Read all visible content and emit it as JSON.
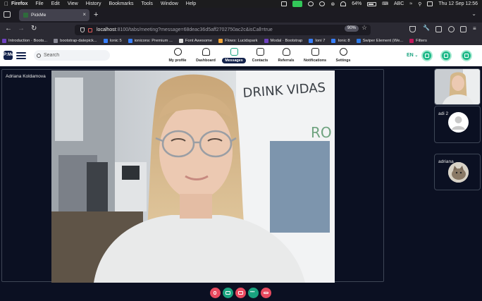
{
  "menubar": {
    "app": "Firefox",
    "menus": [
      "File",
      "Edit",
      "View",
      "History",
      "Bookmarks",
      "Tools",
      "Window",
      "Help"
    ],
    "battery": "64%",
    "input_source": "ABC",
    "datetime": "Thu 12 Sep  12:56"
  },
  "browser": {
    "tab_title": "PickMe",
    "url_host": "localhost",
    "url_path": ":8100/tabs/meeting?message=68deac36d5aff2702750ac2c&isCall=true",
    "zoom": "90%"
  },
  "bookmarks": [
    {
      "label": "Introduction · Boots...",
      "icon": "bootstrap-icon",
      "color": "#6f42c1"
    },
    {
      "label": "bootstrap-datepick...",
      "icon": "document-icon",
      "color": "#8a8a96"
    },
    {
      "label": "Ionic 5",
      "icon": "ionic-icon",
      "color": "#3880ff"
    },
    {
      "label": "ionicons: Premium ...",
      "icon": "ionicons-icon",
      "color": "#3880ff"
    },
    {
      "label": "Font Awesome",
      "icon": "fontawesome-icon",
      "color": "#d9d9d9"
    },
    {
      "label": "Flows: Lucidspark",
      "icon": "lucid-icon",
      "color": "#f2a63a"
    },
    {
      "label": "Modal · Bootstrap",
      "icon": "bootstrap-icon",
      "color": "#6f42c1"
    },
    {
      "label": "Ioni 7",
      "icon": "ionic-icon",
      "color": "#3880ff"
    },
    {
      "label": "Ionic 8",
      "icon": "ionic-icon",
      "color": "#3880ff"
    },
    {
      "label": "Swiper Element (We...",
      "icon": "swiper-icon",
      "color": "#2f7be6"
    },
    {
      "label": "Filters",
      "icon": "filters-icon",
      "color": "#c2185b"
    }
  ],
  "app": {
    "logo": "P:Me",
    "search_placeholder": "Search",
    "nav": [
      {
        "label": "My profile",
        "icon": "user-icon",
        "active": false
      },
      {
        "label": "Dashboard",
        "icon": "home-icon",
        "active": false
      },
      {
        "label": "Messages",
        "icon": "chat-icon",
        "active": true
      },
      {
        "label": "Contacts",
        "icon": "contacts-icon",
        "active": false
      },
      {
        "label": "Referrals",
        "icon": "handshake-icon",
        "active": false
      },
      {
        "label": "Notifications",
        "icon": "bell-icon",
        "active": false
      },
      {
        "label": "Settings",
        "icon": "gear-icon",
        "active": false
      }
    ],
    "language": "EN",
    "accent": "#19a37f",
    "brand": "#13224b"
  },
  "meeting": {
    "main_participant": "Adriana Koldamova",
    "wall_text_1": "DRINK VIDAS",
    "wall_text_2": "RO",
    "participants": [
      {
        "name": "",
        "type": "video"
      },
      {
        "name": "adi 2",
        "type": "default-avatar"
      },
      {
        "name": "adriana",
        "type": "cat-avatar"
      }
    ],
    "controls": [
      {
        "name": "mic-off-button",
        "icon": "mic-off-icon",
        "color": "#e84a5f"
      },
      {
        "name": "camera-button",
        "icon": "video-icon",
        "color": "#19a37f"
      },
      {
        "name": "screen-share-button",
        "icon": "screen-icon",
        "color": "#e84a5f"
      },
      {
        "name": "more-button",
        "icon": "dots-icon",
        "color": "#19a37f"
      },
      {
        "name": "end-call-button",
        "icon": "phone-hangup-icon",
        "color": "#e84a5f"
      }
    ]
  }
}
